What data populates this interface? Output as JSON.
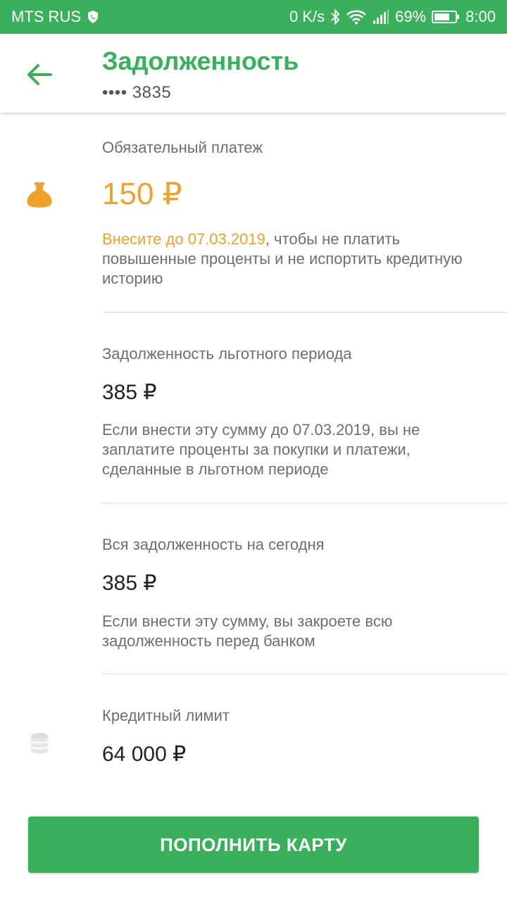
{
  "status_bar": {
    "carrier": "MTS RUS",
    "net_speed": "0 K/s",
    "battery": "69%",
    "time": "8:00"
  },
  "header": {
    "title": "Задолженность",
    "card": "•••• 3835"
  },
  "mandatory": {
    "label": "Обязательный платеж",
    "amount": "150 ₽",
    "pay_by": "Внесите до 07.03.2019",
    "desc_rest": ", чтобы не платить повышенные проценты и не испортить кредитную историю"
  },
  "grace": {
    "label": "Задолженность льготного периода",
    "amount": "385 ₽",
    "desc": "Если внести эту сумму до 07.03.2019, вы не заплатите проценты за покупки и платежи, сделанные в льготном периоде"
  },
  "total": {
    "label": "Вся задолженность на сегодня",
    "amount": "385 ₽",
    "desc": "Если внести эту сумму, вы закроете всю задолженность перед банком"
  },
  "limit": {
    "label": "Кредитный лимит",
    "amount": "64 000 ₽"
  },
  "actions": {
    "top_up": "ПОПОЛНИТЬ КАРТУ"
  },
  "colors": {
    "brand_green": "#3aaf5c",
    "accent_orange": "#f0a12b"
  },
  "icons": [
    "phone-icon",
    "bluetooth-icon",
    "wifi-icon",
    "signal-icon",
    "battery-icon",
    "back-arrow-icon",
    "money-bag-icon",
    "coin-stack-icon"
  ]
}
